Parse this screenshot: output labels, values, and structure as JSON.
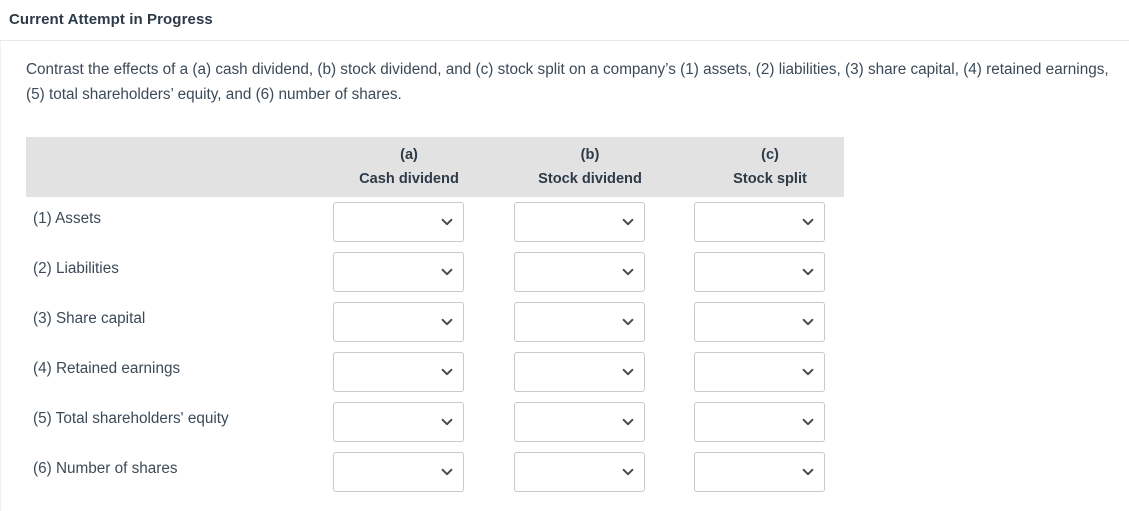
{
  "header": {
    "title": "Current Attempt in Progress"
  },
  "question": {
    "text": "Contrast the effects of a (a) cash dividend, (b) stock dividend, and (c) stock split on a company’s (1) assets, (2) liabilities, (3) share capital, (4) retained earnings, (5) total shareholders’ equity, and (6) number of shares."
  },
  "table": {
    "columns": [
      {
        "letter": "(a)",
        "name": "Cash dividend"
      },
      {
        "letter": "(b)",
        "name": "Stock dividend"
      },
      {
        "letter": "(c)",
        "name": "Stock split"
      }
    ],
    "rows": [
      {
        "label": "(1) Assets",
        "values": [
          "",
          "",
          ""
        ]
      },
      {
        "label": "(2) Liabilities",
        "values": [
          "",
          "",
          ""
        ]
      },
      {
        "label": "(3) Share capital",
        "values": [
          "",
          "",
          ""
        ]
      },
      {
        "label": "(4) Retained earnings",
        "values": [
          "",
          "",
          ""
        ]
      },
      {
        "label": "(5) Total shareholders' equity",
        "values": [
          "",
          "",
          ""
        ]
      },
      {
        "label": "(6) Number of shares",
        "values": [
          "",
          "",
          ""
        ]
      }
    ],
    "dropdown_icon": "chevron-down-icon"
  },
  "colors": {
    "page_background": "#ffffff",
    "title_text": "#2d3b48",
    "body_text": "#3c4a58",
    "table_header_background": "#e2e2e2",
    "input_border": "#c9c9c9",
    "divider": "#e8e8e8",
    "chevron": "#4a4a4a"
  }
}
